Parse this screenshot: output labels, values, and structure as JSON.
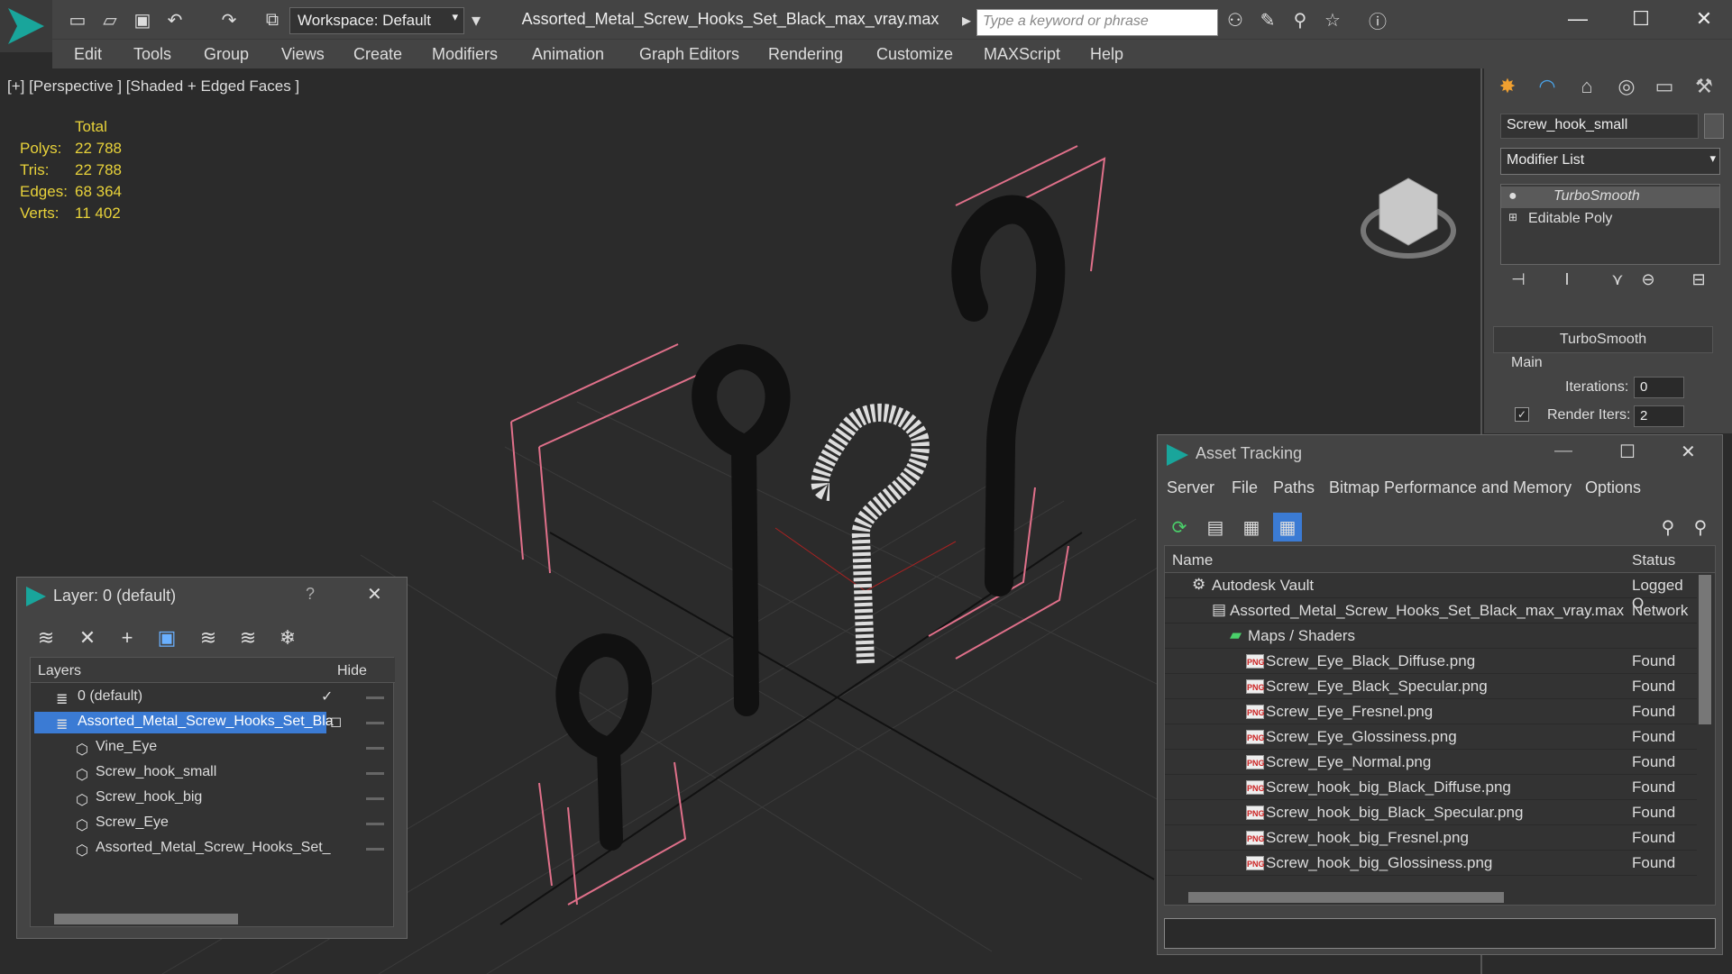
{
  "window": {
    "title": "Assorted_Metal_Screw_Hooks_Set_Black_max_vray.max",
    "workspace": "Workspace: Default",
    "search_placeholder": "Type a keyword or phrase"
  },
  "menu": [
    "Edit",
    "Tools",
    "Group",
    "Views",
    "Create",
    "Modifiers",
    "Animation",
    "Graph Editors",
    "Rendering",
    "Customize",
    "MAXScript",
    "Help"
  ],
  "viewport": {
    "label": "[+] [Perspective ] [Shaded + Edged Faces ]",
    "stats_header": "Total",
    "stats": [
      {
        "label": "Polys:",
        "value": "22 788"
      },
      {
        "label": "Tris:",
        "value": "22 788"
      },
      {
        "label": "Edges:",
        "value": "68 364"
      },
      {
        "label": "Verts:",
        "value": "11 402"
      }
    ]
  },
  "command_panel": {
    "object_name": "Screw_hook_small",
    "modifier_list": "Modifier List",
    "stack": [
      "TurboSmooth",
      "Editable Poly"
    ],
    "rollout_title": "TurboSmooth",
    "group": "Main",
    "iterations_label": "Iterations:",
    "iterations_value": "0",
    "render_iters_label": "Render Iters:",
    "render_iters_value": "2"
  },
  "layer_window": {
    "title": "Layer: 0 (default)",
    "help": "?",
    "col_layers": "Layers",
    "col_hide": "Hide",
    "rows": [
      {
        "name": "0 (default)"
      },
      {
        "name": "Assorted_Metal_Screw_Hooks_Set_Bla"
      },
      {
        "name": "Vine_Eye"
      },
      {
        "name": "Screw_hook_small"
      },
      {
        "name": "Screw_hook_big"
      },
      {
        "name": "Screw_Eye"
      },
      {
        "name": "Assorted_Metal_Screw_Hooks_Set_"
      }
    ]
  },
  "asset_window": {
    "title": "Asset Tracking",
    "menu": [
      "Server",
      "File",
      "Paths",
      "Bitmap Performance and Memory",
      "Options"
    ],
    "col_name": "Name",
    "col_status": "Status",
    "rows": [
      {
        "name": "Autodesk Vault",
        "status": "Logged O"
      },
      {
        "name": "Assorted_Metal_Screw_Hooks_Set_Black_max_vray.max",
        "status": "Network"
      },
      {
        "name": "Maps / Shaders",
        "status": ""
      },
      {
        "name": "Screw_Eye_Black_Diffuse.png",
        "status": "Found"
      },
      {
        "name": "Screw_Eye_Black_Specular.png",
        "status": "Found"
      },
      {
        "name": "Screw_Eye_Fresnel.png",
        "status": "Found"
      },
      {
        "name": "Screw_Eye_Glossiness.png",
        "status": "Found"
      },
      {
        "name": "Screw_Eye_Normal.png",
        "status": "Found"
      },
      {
        "name": "Screw_hook_big_Black_Diffuse.png",
        "status": "Found"
      },
      {
        "name": "Screw_hook_big_Black_Specular.png",
        "status": "Found"
      },
      {
        "name": "Screw_hook_big_Fresnel.png",
        "status": "Found"
      },
      {
        "name": "Screw_hook_big_Glossiness.png",
        "status": "Found"
      }
    ],
    "png_badge": "PNG"
  },
  "colors": {
    "accent": "#19a59b",
    "selection": "#3b7bd4",
    "stats_yellow": "#e8d23a",
    "bbox_pink": "#e0708a"
  }
}
